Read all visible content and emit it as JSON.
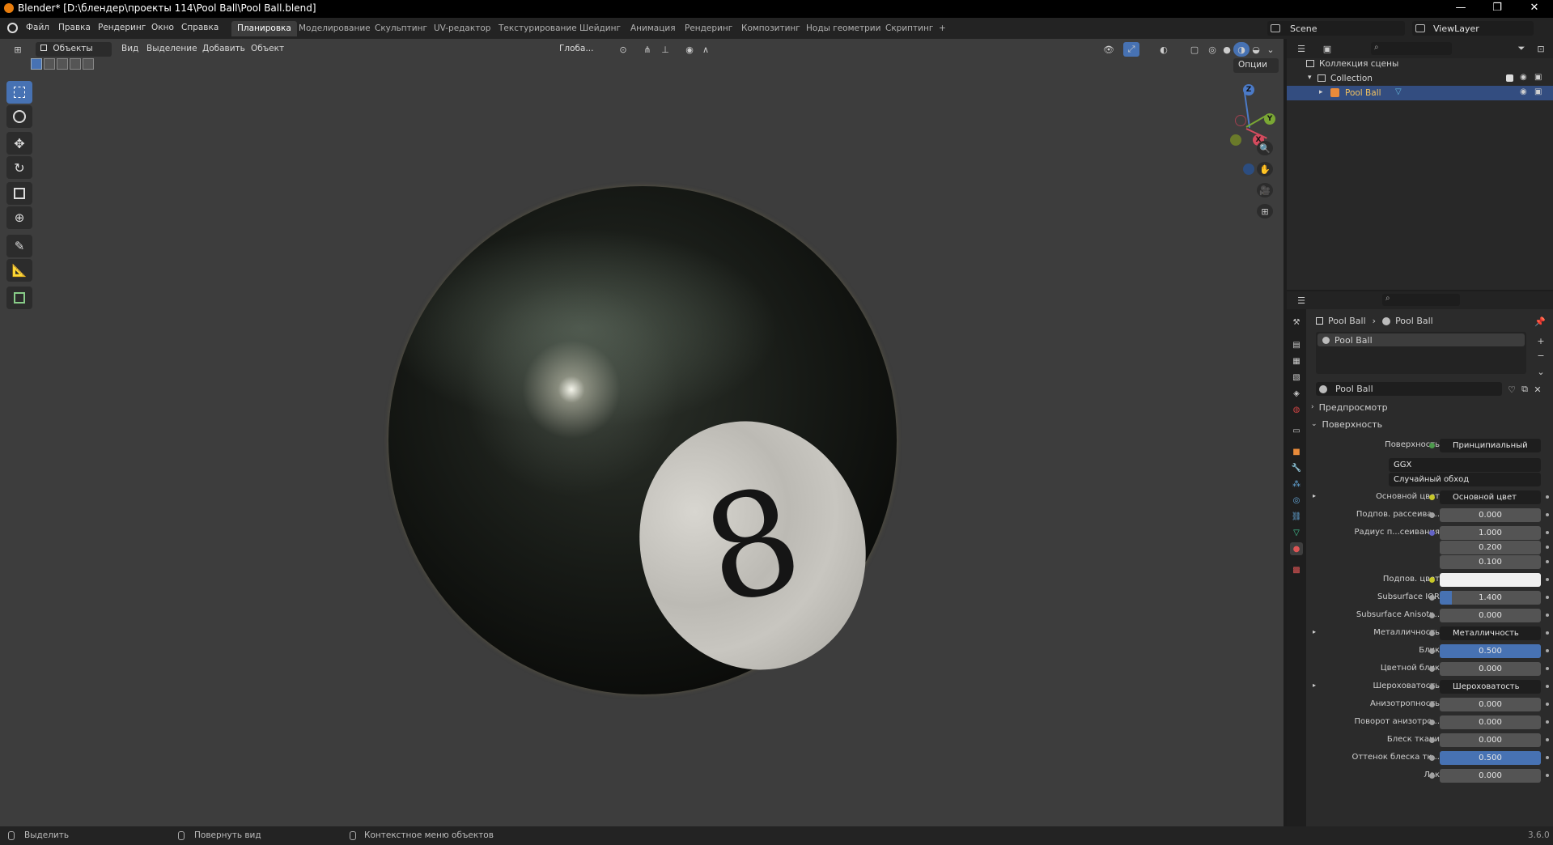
{
  "window": {
    "title": "Blender* [D:\\блендер\\проекты 114\\Pool Ball\\Pool Ball.blend]",
    "minimize": "—",
    "restore": "❐",
    "close": "✕"
  },
  "menu": [
    "Файл",
    "Правка",
    "Рендеринг",
    "Окно",
    "Справка"
  ],
  "workspaces": [
    "Планировка",
    "Моделирование",
    "Скульптинг",
    "UV-редактор",
    "Текстурирование",
    "Шейдинг",
    "Анимация",
    "Рендеринг",
    "Композитинг",
    "Ноды геометрии",
    "Скриптинг"
  ],
  "workspace_add": "+",
  "scene": {
    "name": "Scene",
    "view_layer": "ViewLayer"
  },
  "viewport": {
    "mode": "Объекты",
    "menus": [
      "Вид",
      "Выделение",
      "Добавить",
      "Объект"
    ],
    "transform_orientation": "Глоба...",
    "options_label": "Опции",
    "ball_number": "8",
    "gizmo": {
      "z": "Z",
      "y": "Y",
      "x": "X"
    }
  },
  "outliner": {
    "search_placeholder": "",
    "scene_collection": "Коллекция сцены",
    "collection": "Collection",
    "object": "Pool Ball"
  },
  "properties": {
    "breadcrumb_object": "Pool Ball",
    "breadcrumb_material": "Pool Ball",
    "slot_name": "Pool Ball",
    "material_name": "Pool Ball",
    "panel_preview": "Предпросмотр",
    "panel_surface": "Поверхность",
    "surface_label": "Поверхность",
    "surface_value": "Принципиальный BSDF",
    "distribution": "GGX",
    "subsurface_method": "Случайный обход",
    "rows": [
      {
        "label": "Основной цвет",
        "value": "Основной цвет",
        "kind": "link",
        "expand": true,
        "socket": "#c7c729"
      },
      {
        "label": "Подпов. рассеива...",
        "value": "0.000",
        "kind": "num",
        "fill": 0,
        "socket": "#a1a1a1"
      },
      {
        "label": "Радиус п...сеивания",
        "value": "1.000",
        "kind": "num",
        "fill": 0,
        "socket": "#6363c7"
      },
      {
        "label": "",
        "value": "0.200",
        "kind": "num",
        "fill": 0,
        "socket": ""
      },
      {
        "label": "",
        "value": "0.100",
        "kind": "num",
        "fill": 0,
        "socket": ""
      },
      {
        "label": "Подпов. цвет",
        "value": "",
        "kind": "color",
        "fill": 0,
        "socket": "#c7c729"
      },
      {
        "label": "Subsurface IOR",
        "value": "1.400",
        "kind": "num",
        "fill": 0.12,
        "socket": "#a1a1a1"
      },
      {
        "label": "Subsurface Anisotr...",
        "value": "0.000",
        "kind": "num",
        "fill": 0,
        "socket": "#a1a1a1"
      },
      {
        "label": "Металличность",
        "value": "Металличность",
        "kind": "link",
        "expand": true,
        "socket": "#a1a1a1"
      },
      {
        "label": "Блик",
        "value": "0.500",
        "kind": "num",
        "fill": 1,
        "socket": "#a1a1a1"
      },
      {
        "label": "Цветной блик",
        "value": "0.000",
        "kind": "num",
        "fill": 0,
        "socket": "#a1a1a1"
      },
      {
        "label": "Шероховатость",
        "value": "Шероховатость",
        "kind": "link",
        "expand": true,
        "socket": "#a1a1a1"
      },
      {
        "label": "Анизотропность",
        "value": "0.000",
        "kind": "num",
        "fill": 0,
        "socket": "#a1a1a1"
      },
      {
        "label": "Поворот анизотро...",
        "value": "0.000",
        "kind": "num",
        "fill": 0,
        "socket": "#a1a1a1"
      },
      {
        "label": "Блеск ткани",
        "value": "0.000",
        "kind": "num",
        "fill": 0,
        "socket": "#a1a1a1"
      },
      {
        "label": "Оттенок блеска тк...",
        "value": "0.500",
        "kind": "num",
        "fill": 1,
        "socket": "#a1a1a1"
      },
      {
        "label": "Лак",
        "value": "0.000",
        "kind": "num",
        "fill": 0,
        "socket": "#a1a1a1"
      }
    ]
  },
  "statusbar": {
    "select": "Выделить",
    "rotate": "Повернуть вид",
    "context_menu": "Контекстное меню объектов",
    "version": "3.6.0"
  },
  "colors": {
    "accent": "#4772b3",
    "selection": "#334d80",
    "viewport_bg": "#3d3d3d"
  }
}
